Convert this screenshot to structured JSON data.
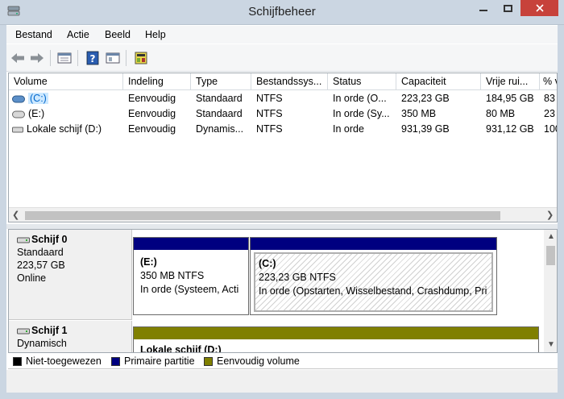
{
  "window": {
    "title": "Schijfbeheer"
  },
  "colors": {
    "title_bg": "#cbd6e2",
    "close": "#c7423b",
    "primary": "#000080",
    "simple": "#808000",
    "unallocated": "#000000"
  },
  "menu": [
    "Bestand",
    "Actie",
    "Beeld",
    "Help"
  ],
  "toolbar": [
    "back-arrow-icon",
    "forward-arrow-icon",
    "disk-list-icon",
    "help-icon",
    "properties-icon",
    "settings-icon"
  ],
  "table": {
    "headers": [
      "Volume",
      "Indeling",
      "Type",
      "Bestandssys...",
      "Status",
      "Capaciteit",
      "Vrije rui...",
      "% v"
    ],
    "rows": [
      [
        "(C:)",
        "Eenvoudig",
        "Standaard",
        "NTFS",
        "In orde (O...",
        "223,23 GB",
        "184,95 GB",
        "83"
      ],
      [
        "(E:)",
        "Eenvoudig",
        "Standaard",
        "NTFS",
        "In orde (Sy...",
        "350 MB",
        "80 MB",
        "23"
      ],
      [
        "Lokale schijf (D:)",
        "Eenvoudig",
        "Dynamis...",
        "NTFS",
        "In orde",
        "931,39 GB",
        "931,12 GB",
        "100"
      ]
    ]
  },
  "disks": [
    {
      "name": "Schijf 0",
      "type": "Standaard",
      "size": "223,57 GB",
      "state": "Online",
      "partitions": [
        {
          "label": "(E:)",
          "size": "350 MB NTFS",
          "status": "In orde (Systeem, Acti"
        },
        {
          "label": "(C:)",
          "size": "223,23 GB NTFS",
          "status": "In orde (Opstarten, Wisselbestand, Crashdump, Pri"
        }
      ]
    },
    {
      "name": "Schijf 1",
      "type": "Dynamisch",
      "partitions": [
        {
          "label": "Lokale schijf  (D:)"
        }
      ]
    }
  ],
  "legend": [
    {
      "label": "Niet-toegewezen",
      "color": "#000000"
    },
    {
      "label": "Primaire partitie",
      "color": "#000080"
    },
    {
      "label": "Eenvoudig volume",
      "color": "#808000"
    }
  ]
}
